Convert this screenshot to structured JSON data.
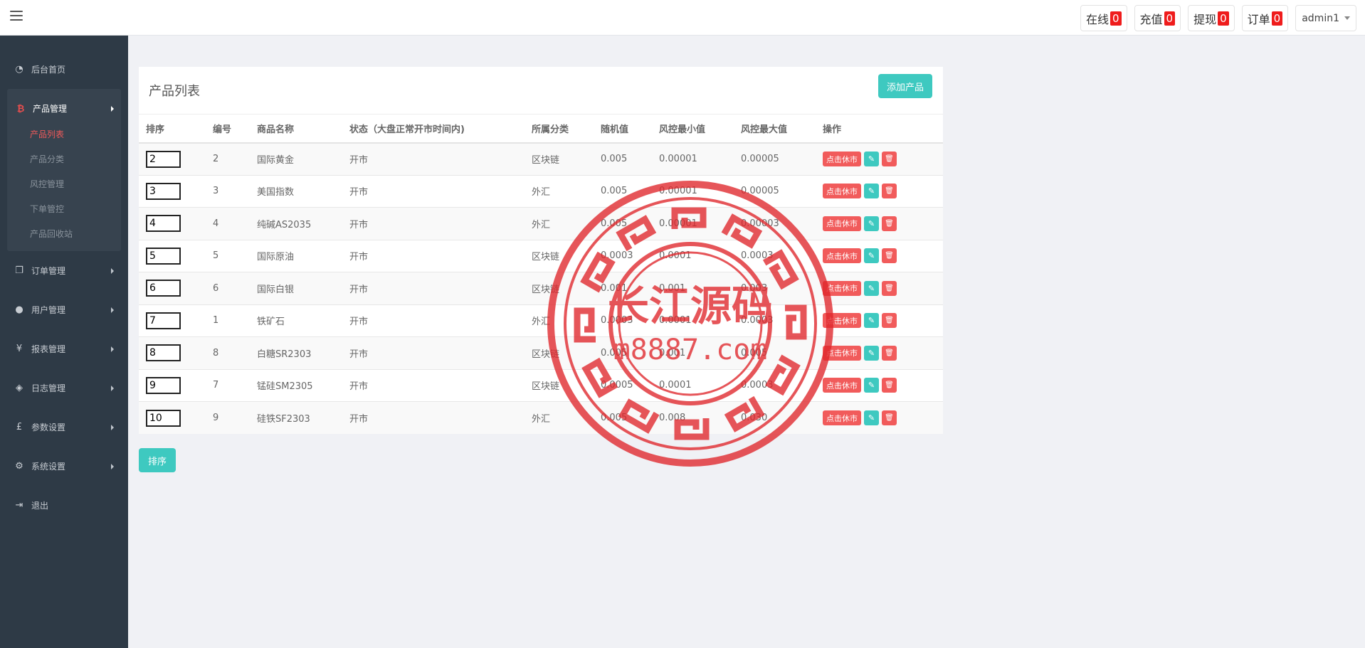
{
  "topbar": {
    "pills": [
      {
        "label": "在线",
        "count": "0"
      },
      {
        "label": "充值",
        "count": "0"
      },
      {
        "label": "提现",
        "count": "0"
      },
      {
        "label": "订单",
        "count": "0"
      }
    ],
    "user": "admin1"
  },
  "sidebar": {
    "items": [
      {
        "label": "后台首页",
        "icon": "dashboard-icon"
      },
      {
        "label": "产品管理",
        "icon": "bitcoin-icon"
      },
      {
        "label": "订单管理",
        "icon": "copy-icon"
      },
      {
        "label": "用户管理",
        "icon": "user-icon"
      },
      {
        "label": "报表管理",
        "icon": "yen-icon"
      },
      {
        "label": "日志管理",
        "icon": "tag-icon"
      },
      {
        "label": "参数设置",
        "icon": "pound-icon"
      },
      {
        "label": "系统设置",
        "icon": "gears-icon"
      },
      {
        "label": "退出",
        "icon": "sign-out-icon"
      }
    ],
    "sub_items": [
      "产品列表",
      "产品分类",
      "风控管理",
      "下单管控",
      "产品回收站"
    ]
  },
  "panel": {
    "title": "产品列表",
    "add_label": "添加产品",
    "columns": [
      "排序",
      "编号",
      "商品名称",
      "状态（大盘正常开市时间内)",
      "所属分类",
      "随机值",
      "风控最小值",
      "风控最大值",
      "操作"
    ],
    "rows": [
      {
        "sort": "2",
        "id": "2",
        "name": "国际黄金",
        "status": "开市",
        "category": "区块链",
        "random": "0.005",
        "min": "0.00001",
        "max": "0.00005"
      },
      {
        "sort": "3",
        "id": "3",
        "name": "美国指数",
        "status": "开市",
        "category": "外汇",
        "random": "0.005",
        "min": "0.00001",
        "max": "0.00005"
      },
      {
        "sort": "4",
        "id": "4",
        "name": "纯碱AS2035",
        "status": "开市",
        "category": "外汇",
        "random": "0.005",
        "min": "0.00001",
        "max": "0.00003"
      },
      {
        "sort": "5",
        "id": "5",
        "name": "国际原油",
        "status": "开市",
        "category": "区块链",
        "random": "0.0003",
        "min": "0.0001",
        "max": "0.0003"
      },
      {
        "sort": "6",
        "id": "6",
        "name": "国际白银",
        "status": "开市",
        "category": "区块链",
        "random": "0.001",
        "min": "0.001",
        "max": "0.003"
      },
      {
        "sort": "7",
        "id": "1",
        "name": "铁矿石",
        "status": "开市",
        "category": "外汇",
        "random": "0.0003",
        "min": "0.0001",
        "max": "0.0003"
      },
      {
        "sort": "8",
        "id": "8",
        "name": "白糖SR2303",
        "status": "开市",
        "category": "区块链",
        "random": "0.005",
        "min": "0.001",
        "max": "0.005"
      },
      {
        "sort": "9",
        "id": "7",
        "name": "锰硅SM2305",
        "status": "开市",
        "category": "区块链",
        "random": "0.0005",
        "min": "0.0001",
        "max": "0.0003"
      },
      {
        "sort": "10",
        "id": "9",
        "name": "硅铁SF2303",
        "status": "开市",
        "category": "外汇",
        "random": "0.005",
        "min": "0.008",
        "max": "0.030"
      }
    ],
    "close_label": "点击休市"
  },
  "sort_button": "排序",
  "watermark": {
    "line1": "长江源码",
    "line2": "m8887.com"
  },
  "colors": {
    "accent": "#3ec9c0",
    "danger": "#f15b5b",
    "sidebar": "#2e3a46",
    "badge": "#ef1c1c"
  }
}
